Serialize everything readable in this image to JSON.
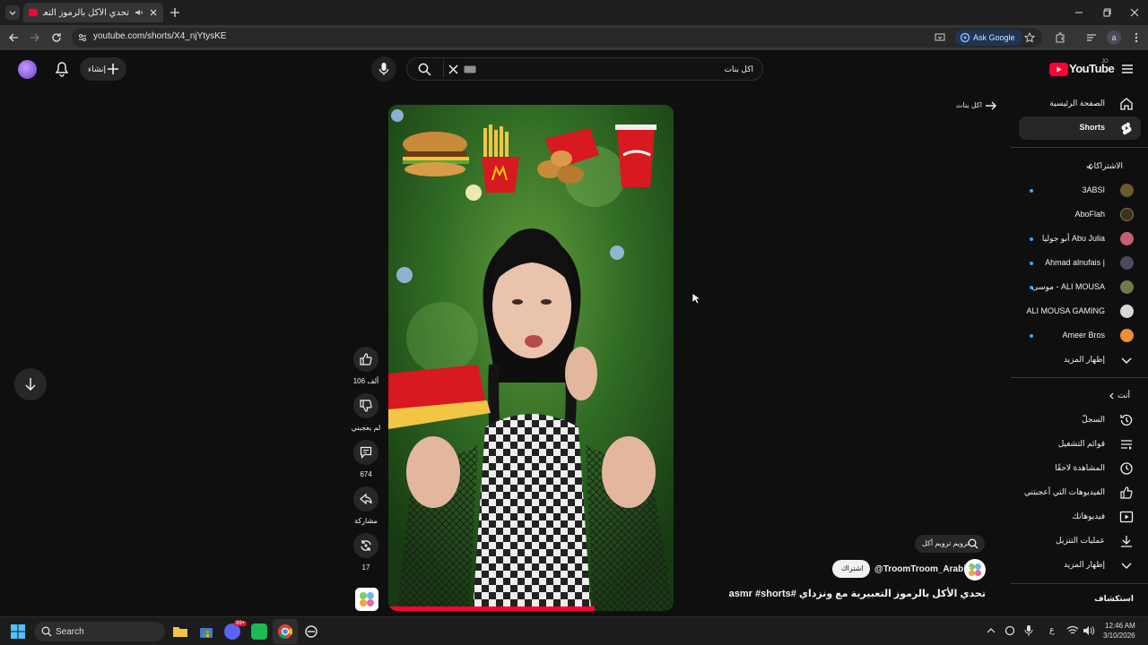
{
  "browser": {
    "tab_title": "تحدي الأكل بالرموز التعبيرية",
    "url": "youtube.com/shorts/X4_njYtysKE",
    "ask_google": "Ask Google",
    "profile_letter": "a"
  },
  "header": {
    "create_label": "إنشاء",
    "search_value": "اكل بنات",
    "logo_text": "YouTube",
    "logo_region": "JO"
  },
  "sidebar": {
    "home": "الصفحة الرئيسية",
    "shorts": "Shorts",
    "subscriptions_title": "الاشتراكات",
    "subscriptions": [
      {
        "name": "3ABSI",
        "dot": true,
        "color": "#6b5a2e"
      },
      {
        "name": "AboFlah",
        "dot": false,
        "color": "#3b3320"
      },
      {
        "name": "Abu Julia أبو جوليا",
        "dot": true,
        "color": "#c2626e"
      },
      {
        "name": "| Ahmad alnufais",
        "dot": true,
        "color": "#4a4a5a"
      },
      {
        "name": "ALI MOUSA - موسى",
        "dot": true,
        "color": "#6e7a4a"
      },
      {
        "name": "ALI MOUSA GAMING",
        "dot": false,
        "color": "#d8d8d8"
      },
      {
        "name": "Ameer Bros",
        "dot": true,
        "color": "#f08c3a"
      }
    ],
    "show_more": "إظهار المزيد",
    "you_title": "أنت",
    "you_items": [
      {
        "label": "السجلّ",
        "icon": "history-icon"
      },
      {
        "label": "قوائم التشغيل",
        "icon": "playlists-icon"
      },
      {
        "label": "المشاهدة لاحقًا",
        "icon": "watch-later-icon"
      },
      {
        "label": "الفيديوهات التي أعجبتني",
        "icon": "liked-videos-icon"
      },
      {
        "label": "فيديوهاتك",
        "icon": "your-videos-icon"
      },
      {
        "label": "عمليات التنزيل",
        "icon": "downloads-icon"
      }
    ],
    "show_more_2": "إظهار المزيد",
    "explore_title": "استكشاف"
  },
  "shorts_page": {
    "related_search": "اكل بنات",
    "actions": {
      "like_count": "106 ألف",
      "dislike_label": "لم يعجبني",
      "comment_count": "674",
      "share_label": "مشاركة",
      "remix_count": "17"
    },
    "search_pill": "ترويم ترويم أكل",
    "channel": "@TroomTroom_Arabic",
    "subscribe": "اشتراك",
    "video_title": "تحدي الأكل بالرموز التعبيرية مع ونزداي #asmr #shorts"
  },
  "taskbar": {
    "search": "Search",
    "time": "12:46 AM",
    "date": "3/10/2026",
    "lang": "ع",
    "badge": "99+"
  },
  "colors": {
    "accent_red": "#ff0033",
    "link_blue": "#3ea6ff",
    "ask_google_bg": "#1f3552"
  }
}
